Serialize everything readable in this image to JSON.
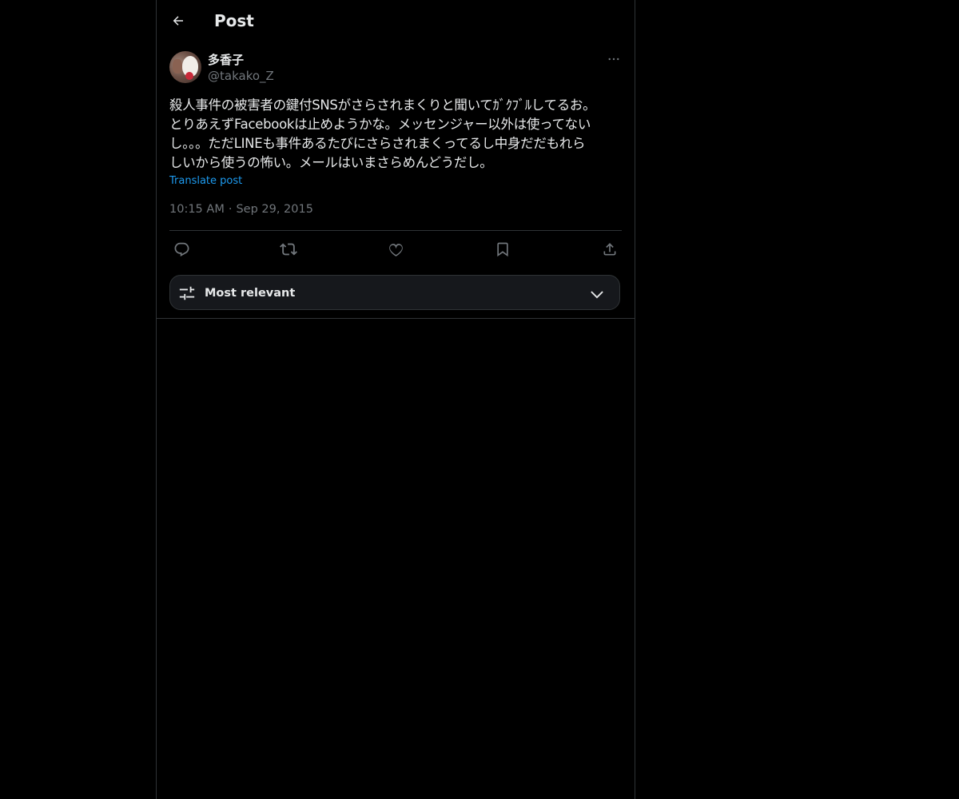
{
  "header": {
    "title": "Post",
    "back_icon": "arrow-left-icon"
  },
  "author": {
    "display_name": "多香子",
    "handle": "@takako_Z"
  },
  "post": {
    "text": "殺人事件の被害者の鍵付SNSがさらされまくりと聞いてｶﾞｸﾌﾞﾙしてるお。\nとりあえずFacebookは止めようかな。メッセンジャー以外は使ってない\nし。。。ただLINEも事件あるたびにさらされまくってるし中身だだもれら\nしいから使うの怖い。メールはいまさらめんどうだし。",
    "translate_label": "Translate post",
    "time": "10:15 AM",
    "date": "Sep 29, 2015"
  },
  "actions": {
    "reply_icon": "reply-icon",
    "repost_icon": "repost-icon",
    "like_icon": "heart-icon",
    "bookmark_icon": "bookmark-icon",
    "share_icon": "share-icon"
  },
  "sort": {
    "label": "Most relevant"
  },
  "colors": {
    "background": "#000000",
    "text": "#e7e9ea",
    "muted": "#71767b",
    "link": "#1d9bf0",
    "border": "#2f3336"
  }
}
